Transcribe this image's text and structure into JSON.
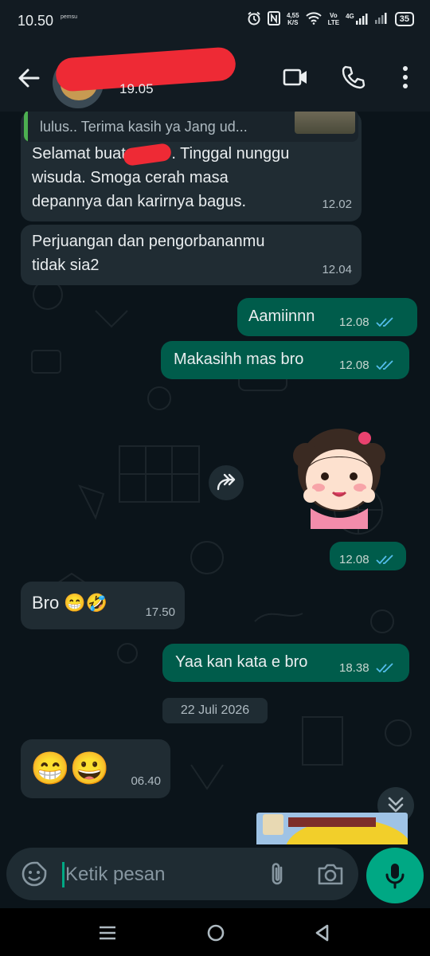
{
  "status_bar": {
    "time": "10.50",
    "net_label_1": "pemsu",
    "speed_value": "4,55",
    "speed_unit": "K/S",
    "volte_top": "Vo",
    "volte_bottom": "LTE",
    "network": "4G",
    "battery": "35"
  },
  "header": {
    "last_seen": "19.05"
  },
  "messages": [
    {
      "id": "m1",
      "direction": "in",
      "reply_quote": "lulus.. Terima kasih ya Jang ud...",
      "line1_before": "Selamat buat",
      "line1_after": ". Tinggal nunggu",
      "line2": "wisuda. Smoga cerah masa",
      "line3": "depannya dan karirnya bagus.",
      "time": "12.02"
    },
    {
      "id": "m2",
      "direction": "in",
      "line1": "Perjuangan dan pengorbananmu",
      "line2": "tidak sia2",
      "time": "12.04"
    },
    {
      "id": "m3",
      "direction": "out",
      "text": "Aamiinnn",
      "time": "12.08"
    },
    {
      "id": "m4",
      "direction": "out",
      "text": "Makasihh mas bro",
      "time": "12.08"
    },
    {
      "id": "m5",
      "direction": "out",
      "type": "sticker",
      "time": "12.08"
    },
    {
      "id": "m6",
      "direction": "in",
      "text": "Bro 😁🤣",
      "time": "17.50"
    },
    {
      "id": "m7",
      "direction": "out",
      "text": "Yaa kan kata e bro",
      "time": "18.38"
    },
    {
      "id": "m8",
      "direction": "in",
      "text": "😁😀",
      "time": "06.40"
    }
  ],
  "date_divider": "22 Juli 2026",
  "input": {
    "placeholder": "Ketik pesan"
  },
  "colors": {
    "incoming_bubble": "#202c33",
    "outgoing_bubble": "#005c4b",
    "accent": "#00a884",
    "read_ticks": "#53bdeb"
  }
}
